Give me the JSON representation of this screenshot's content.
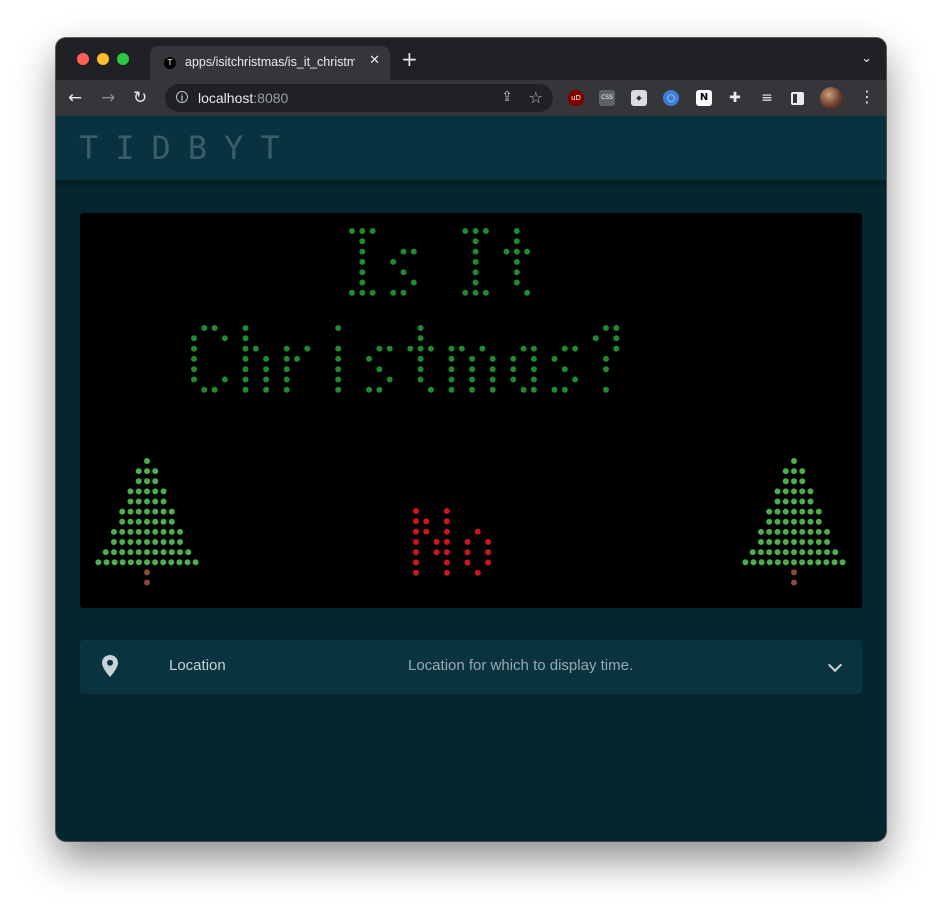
{
  "browser": {
    "tab_title": "apps/isitchristmas/is_it_christmas",
    "tab_favicon": "T",
    "url_host": "localhost",
    "url_port": ":8080",
    "icons": [
      "back-arrow-icon",
      "forward-arrow-icon",
      "reload-icon",
      "info-icon",
      "share-icon",
      "star-icon",
      "ublock-icon",
      "css-icon",
      "eraser-icon",
      "ring-icon",
      "notion-icon",
      "puzzle-icon",
      "queue-icon",
      "sidepanel-icon",
      "avatar",
      "kebab-menu-icon"
    ]
  },
  "app": {
    "logo": "TIDBYT"
  },
  "display": {
    "title_line1": "Is It",
    "title_line2": "Christmas?",
    "answer": "No",
    "colors": {
      "title": "#1f8a2e",
      "answer": "#d0141c",
      "tree": "#4cae4c",
      "trunk": "#8a4b3b"
    }
  },
  "config": {
    "icon": "location-pin-icon",
    "label": "Location",
    "description": "Location for which to display time."
  }
}
